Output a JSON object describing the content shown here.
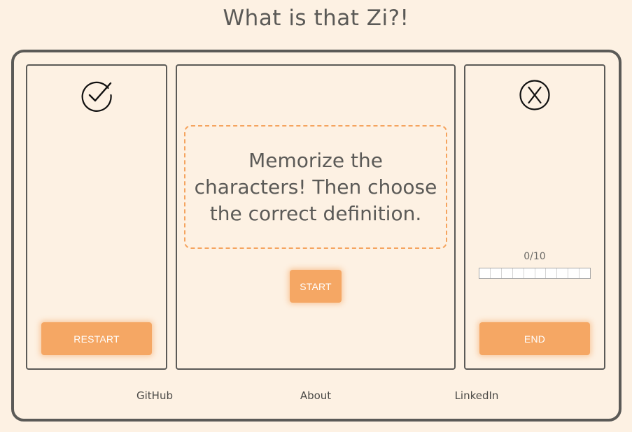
{
  "header": {
    "title": "What is that Zi?!"
  },
  "left_panel": {
    "icon": "check-circle-icon",
    "restart_label": "RESTART"
  },
  "center_panel": {
    "instructions": "Memorize the characters! Then choose the correct definition.",
    "start_label": "START"
  },
  "right_panel": {
    "icon": "x-circle-icon",
    "score_text": "0/10",
    "progress": 0,
    "progress_segments": 10,
    "end_label": "END"
  },
  "footer": {
    "links": [
      {
        "label": "GitHub"
      },
      {
        "label": "About"
      },
      {
        "label": "LinkedIn"
      }
    ]
  },
  "colors": {
    "background": "#fdf1e3",
    "border": "#5b5a57",
    "accent": "#f5a764",
    "dashed": "#f5a45f"
  }
}
